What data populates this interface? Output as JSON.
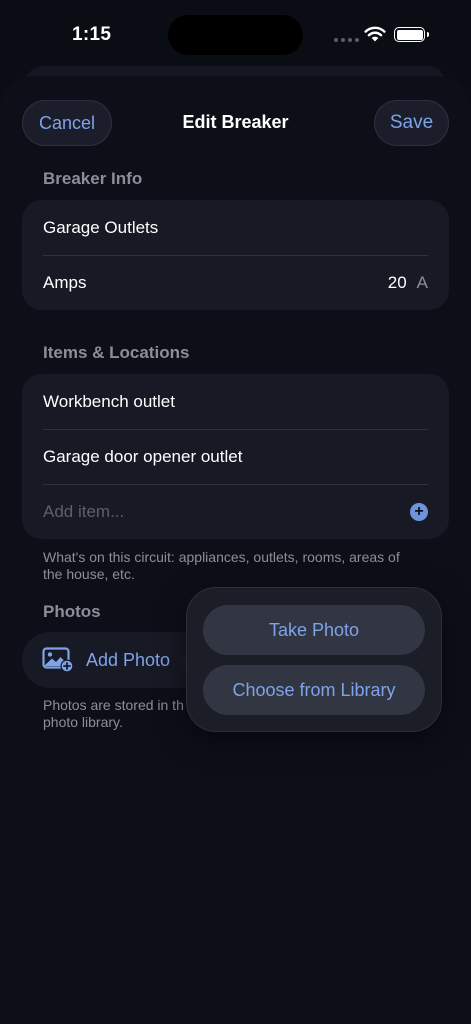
{
  "status_bar": {
    "time": "1:15"
  },
  "nav": {
    "cancel_label": "Cancel",
    "title": "Edit Breaker",
    "save_label": "Save"
  },
  "breaker_info": {
    "header": "Breaker Info",
    "name": "Garage Outlets",
    "amps_label": "Amps",
    "amps_value": "20",
    "amps_unit": "A"
  },
  "items_locations": {
    "header": "Items & Locations",
    "items": [
      "Workbench outlet",
      "Garage door opener outlet"
    ],
    "add_placeholder": "Add item...",
    "footer": "What's on this circuit: appliances, outlets, rooms, areas of the house, etc."
  },
  "photos": {
    "header": "Photos",
    "add_label": "Add Photo",
    "footer_line1": "Photos are stored in th",
    "footer_line2": "photo library."
  },
  "popover": {
    "take_photo": "Take Photo",
    "choose_library": "Choose from Library"
  },
  "colors": {
    "accent": "#7ea3e8",
    "background": "#0b0d15",
    "card": "#171924",
    "secondary_text": "#8b8e99"
  }
}
